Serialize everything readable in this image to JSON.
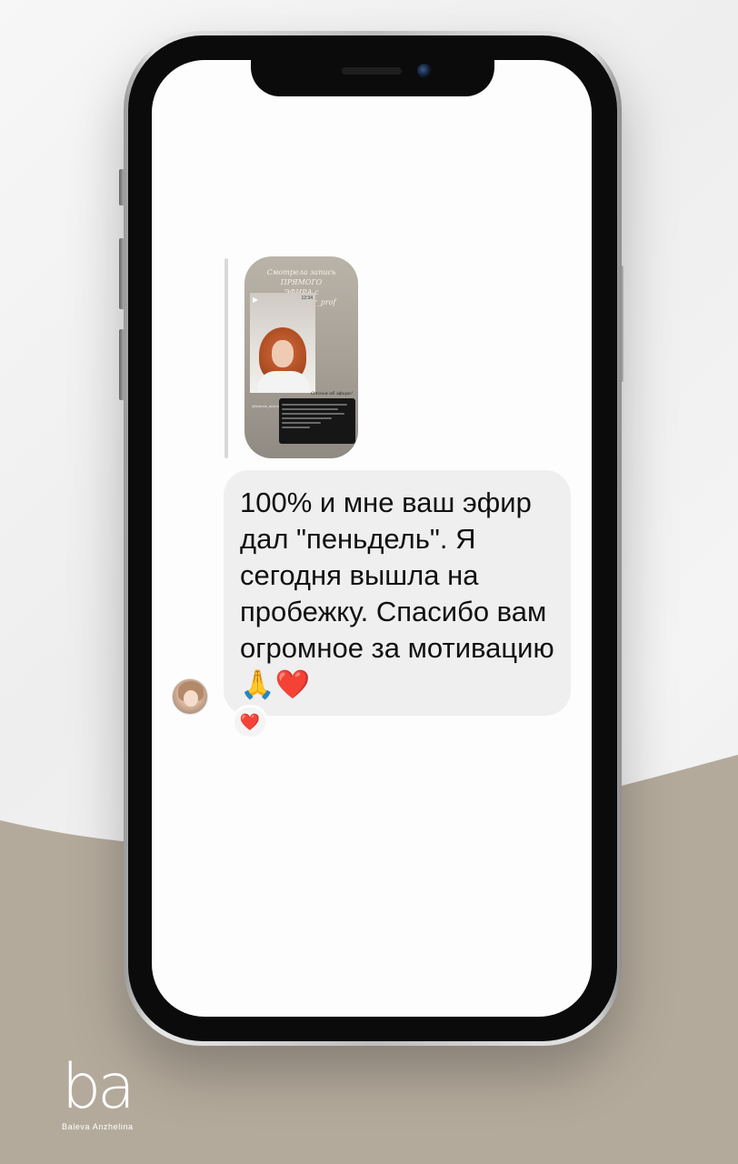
{
  "story": {
    "title_line1": "Смотрела запись ПРЯМОГО",
    "title_line2": "ЭФИРА с @balle_ender_prof",
    "video_time": "12:34",
    "caption_right": "Отзыв об эфире!",
    "handle": "@balevia_anzhe",
    "icon": "play-icon"
  },
  "message": {
    "text": "100% и мне ваш эфир дал \"пеньдель\". Я сегодня вышла на пробежку.  Спасибо вам огромное за мотивацию",
    "emoji": "🙏❤️"
  },
  "reaction": {
    "emoji": "❤️"
  },
  "brand": {
    "logo_text": "ba",
    "caption": "Baleva Anzhelina",
    "colors": {
      "beige": "#b4aa9c",
      "bubble": "#efefef"
    }
  }
}
